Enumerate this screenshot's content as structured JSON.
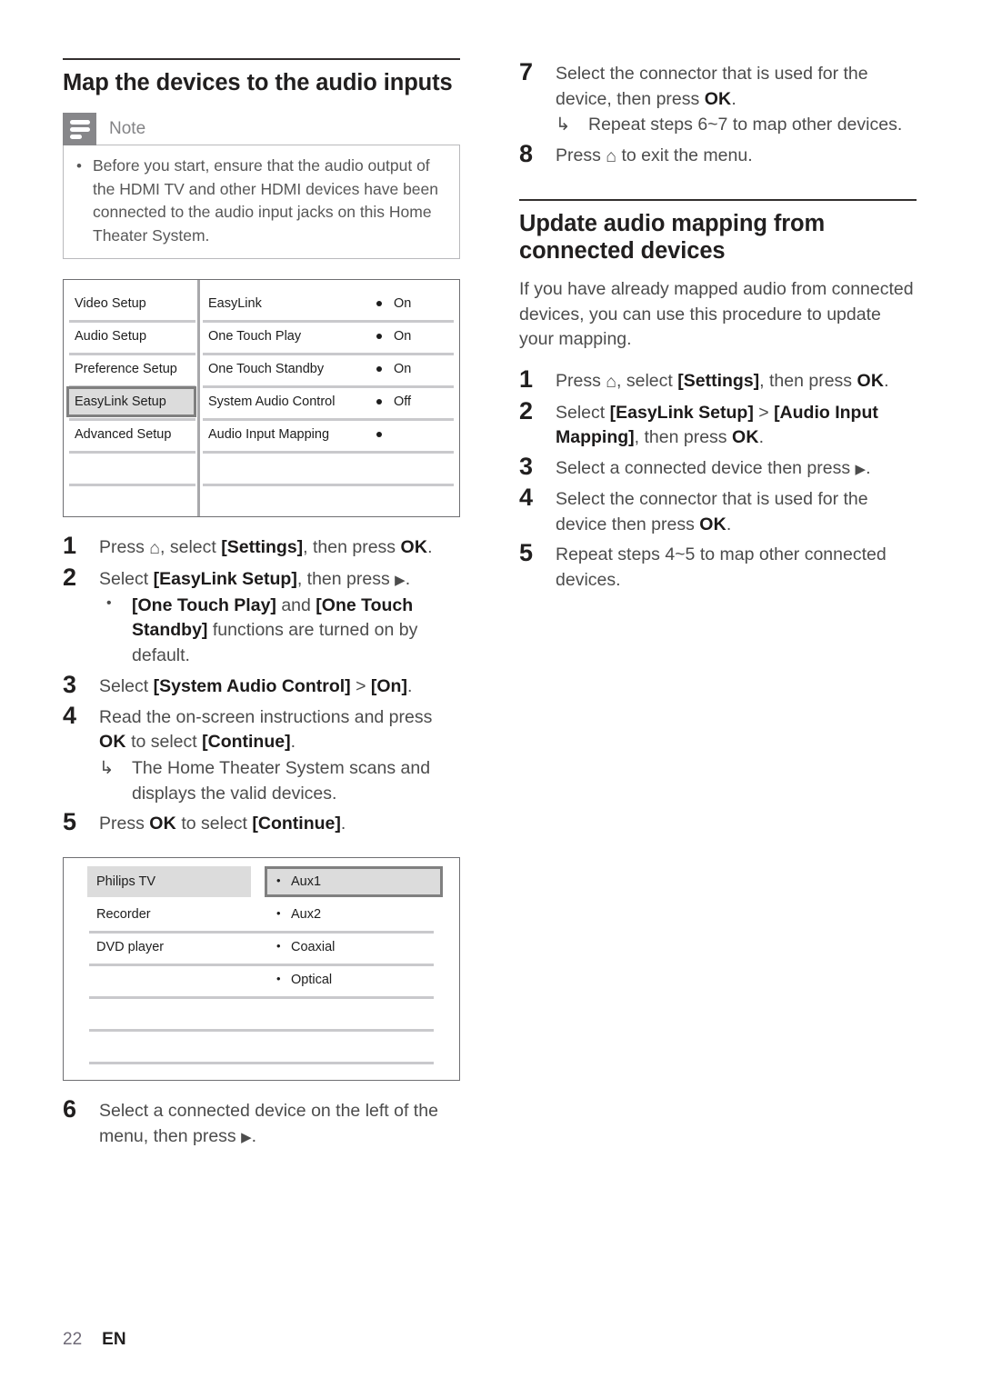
{
  "page": {
    "number": "22",
    "language": "EN"
  },
  "left_column": {
    "section_title": "Map the devices to the audio inputs",
    "note": {
      "label": "Note",
      "icon": "note-lines-icon",
      "bullet": "•",
      "items": [
        "Before you start, ensure that the audio output of the HDMI TV and other HDMI devices have been connected to the audio input jacks on this Home Theater System."
      ]
    },
    "menu_screenshot_1": {
      "left_menu": [
        "Video Setup",
        "Audio Setup",
        "Preference Setup",
        "EasyLink Setup",
        "Advanced Setup"
      ],
      "left_selected": "EasyLink Setup",
      "right_menu": [
        {
          "label": "EasyLink",
          "value": "On"
        },
        {
          "label": "One Touch Play",
          "value": "On"
        },
        {
          "label": "One Touch Standby",
          "value": "On"
        },
        {
          "label": "System Audio Control",
          "value": "Off"
        },
        {
          "label": "Audio Input Mapping",
          "value": ""
        }
      ]
    },
    "steps": [
      {
        "num": "1",
        "html": "Press <span class=\"home-icon\" data-name=\"home-icon\">⌂</span>, select <b>[Settings]</b>, then press <span class=\"ok\">OK</span>."
      },
      {
        "num": "2",
        "html": "Select <b>[EasyLink Setup]</b>, then press <span class=\"tri\">▶</span>.",
        "subs": [
          {
            "mark": "•",
            "type": "bullet",
            "html": "<b>[One Touch Play]</b> and <b>[One Touch Standby]</b> functions are turned on by default."
          }
        ]
      },
      {
        "num": "3",
        "html": "Select <b>[System Audio Control]</b> &gt; <b>[On]</b>."
      },
      {
        "num": "4",
        "html": "Read the on-screen instructions and press <span class=\"ok\">OK</span> to select <b>[Continue]</b>.",
        "subs": [
          {
            "mark": "↳",
            "type": "arrow",
            "html": "The Home Theater System scans and displays the valid devices."
          }
        ]
      },
      {
        "num": "5",
        "html": "Press <span class=\"ok\">OK</span> to select <b>[Continue]</b>."
      }
    ],
    "menu_screenshot_2": {
      "devices": [
        "Philips TV",
        "Recorder",
        "DVD player"
      ],
      "device_selected": "Philips TV",
      "connectors": [
        "Aux1",
        "Aux2",
        "Coaxial",
        "Optical"
      ],
      "connector_selected": "Aux1",
      "connector_bullet": "•"
    },
    "steps_after_table": [
      {
        "num": "6",
        "html": "Select a connected device on the left of the menu, then press <span class=\"tri\">▶</span>."
      }
    ]
  },
  "right_column": {
    "steps_continued": [
      {
        "num": "7",
        "html": "Select the connector that is used for the device, then press <span class=\"ok\">OK</span>.",
        "subs": [
          {
            "mark": "↳",
            "type": "arrow",
            "html": "Repeat steps 6~7 to map other devices."
          }
        ]
      },
      {
        "num": "8",
        "html": "Press <span class=\"home-icon\" data-name=\"home-icon\">⌂</span> to exit the menu."
      }
    ],
    "section_title": "Update audio mapping from connected devices",
    "intro": "If you have already mapped audio from connected devices, you can use this procedure to update your mapping.",
    "steps": [
      {
        "num": "1",
        "html": "Press <span class=\"home-icon\" data-name=\"home-icon\">⌂</span>, select <b>[Settings]</b>, then press <span class=\"ok\">OK</span>."
      },
      {
        "num": "2",
        "html": "Select <b>[EasyLink Setup]</b> &gt; <b>[Audio Input Mapping]</b>, then press <span class=\"ok\">OK</span>."
      },
      {
        "num": "3",
        "html": "Select a connected device then press <span class=\"tri\">▶</span>."
      },
      {
        "num": "4",
        "html": "Select the connector that is used for the device then press <span class=\"ok\">OK</span>."
      },
      {
        "num": "5",
        "html": "Repeat steps 4~5 to map other connected devices."
      }
    ]
  },
  "colors": {
    "note_icon_bg": "#87878a",
    "highlight_fill": "#dcdcdc",
    "highlight_border": "#808080",
    "table_border": "#6f6f72",
    "row_divider": "#c9c9cc",
    "heading_rule": "#332f2e"
  }
}
